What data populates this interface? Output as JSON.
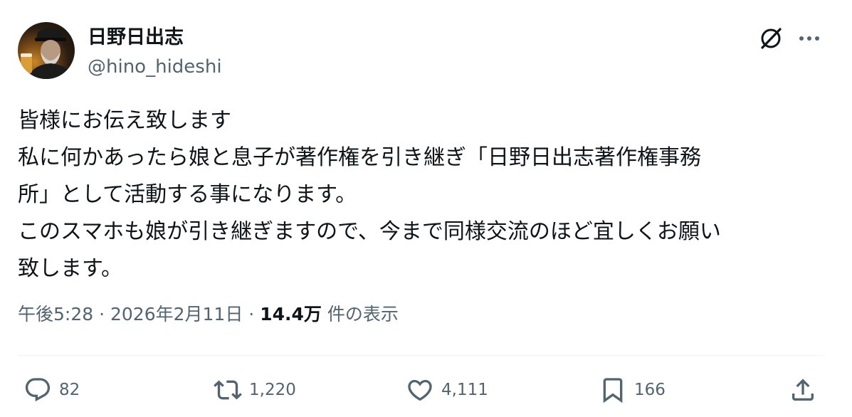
{
  "author": {
    "display_name": "日野日出志",
    "handle": "@hino_hideshi"
  },
  "tweet": {
    "lines": [
      "皆様にお伝え致します",
      "私に何かあったら娘と息子が著作権を引き継ぎ「日野日出志著作権事務",
      "所」として活動する事になります。",
      "このスマホも娘が引き継ぎますので、今まで同様交流のほど宜しくお願い",
      "致します。"
    ]
  },
  "meta": {
    "time": "午後5:28",
    "sep1": "·",
    "date": "2026年2月11日",
    "sep2": "·",
    "views": "14.4万",
    "views_suffix": "件の表示"
  },
  "actions": {
    "reply_count": "82",
    "retweet_count": "1,220",
    "like_count": "4,111",
    "bookmark_count": "166"
  },
  "icons": {
    "grok": "grok-icon",
    "more": "more-icon",
    "reply": "reply-icon",
    "retweet": "retweet-icon",
    "like": "heart-icon",
    "bookmark": "bookmark-icon",
    "share": "share-icon"
  },
  "colors": {
    "text_primary": "#0f1419",
    "text_secondary": "#536471",
    "divider": "#eff3f4"
  }
}
